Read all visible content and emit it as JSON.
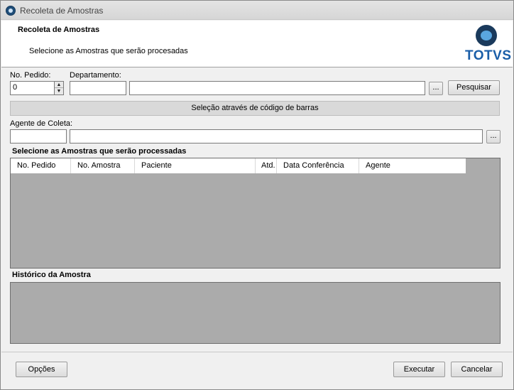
{
  "window": {
    "title": "Recoleta de Amostras"
  },
  "header": {
    "title": "Recoleta de Amostras",
    "subtitle": "Selecione as Amostras que serão procesadas",
    "logo_text": "TOTVS"
  },
  "filters": {
    "no_pedido_label": "No. Pedido:",
    "no_pedido_value": "0",
    "departamento_label": "Departamento:",
    "departamento_code": "",
    "departamento_name": "",
    "browse_label": "...",
    "pesquisar_label": "Pesquisar"
  },
  "barcode_button_label": "Seleção através de código de barras",
  "agente": {
    "label": "Agente de Coleta:",
    "code": "",
    "name": "",
    "browse_label": "..."
  },
  "samples": {
    "title": "Selecione as Amostras que serão processadas",
    "columns": [
      "No. Pedido",
      "No. Amostra",
      "Paciente",
      "Atd.",
      "Data Conferência",
      "Agente"
    ],
    "rows": []
  },
  "history": {
    "title": "Histórico da Amostra"
  },
  "footer": {
    "opcoes_label": "Opções",
    "executar_label": "Executar",
    "cancelar_label": "Cancelar"
  },
  "colors": {
    "grid_bg": "#ababab",
    "logo_blue": "#1a5ea8"
  }
}
